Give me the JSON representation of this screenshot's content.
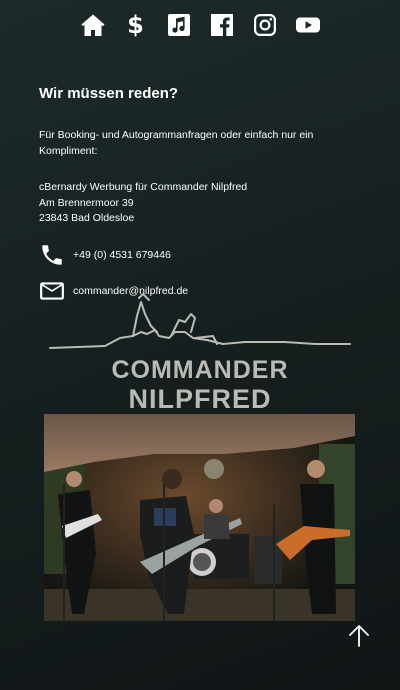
{
  "nav": {
    "icons": [
      "home-icon",
      "dollar-icon",
      "music-icon",
      "facebook-icon",
      "instagram-icon",
      "youtube-icon"
    ],
    "dollar_symbol": "$"
  },
  "contact": {
    "heading": "Wir müssen reden?",
    "intro": "Für Booking- und Autogrammanfragen oder einfach nur ein Kompliment:",
    "address_line1": "cBernardy Werbung für Commander Nilpfred",
    "address_line2": "Am Brennermoor 39",
    "address_line3": "23843 Bad Oldesloe",
    "phone": "+49 (0) 4531 679446",
    "email": "commander@nilpfred.de"
  },
  "logo": {
    "line1": "COMMANDER",
    "line2": "NILPFRED"
  },
  "colors": {
    "background": "#172020",
    "text": "#ffffff",
    "logo": "#b8b8b0"
  }
}
